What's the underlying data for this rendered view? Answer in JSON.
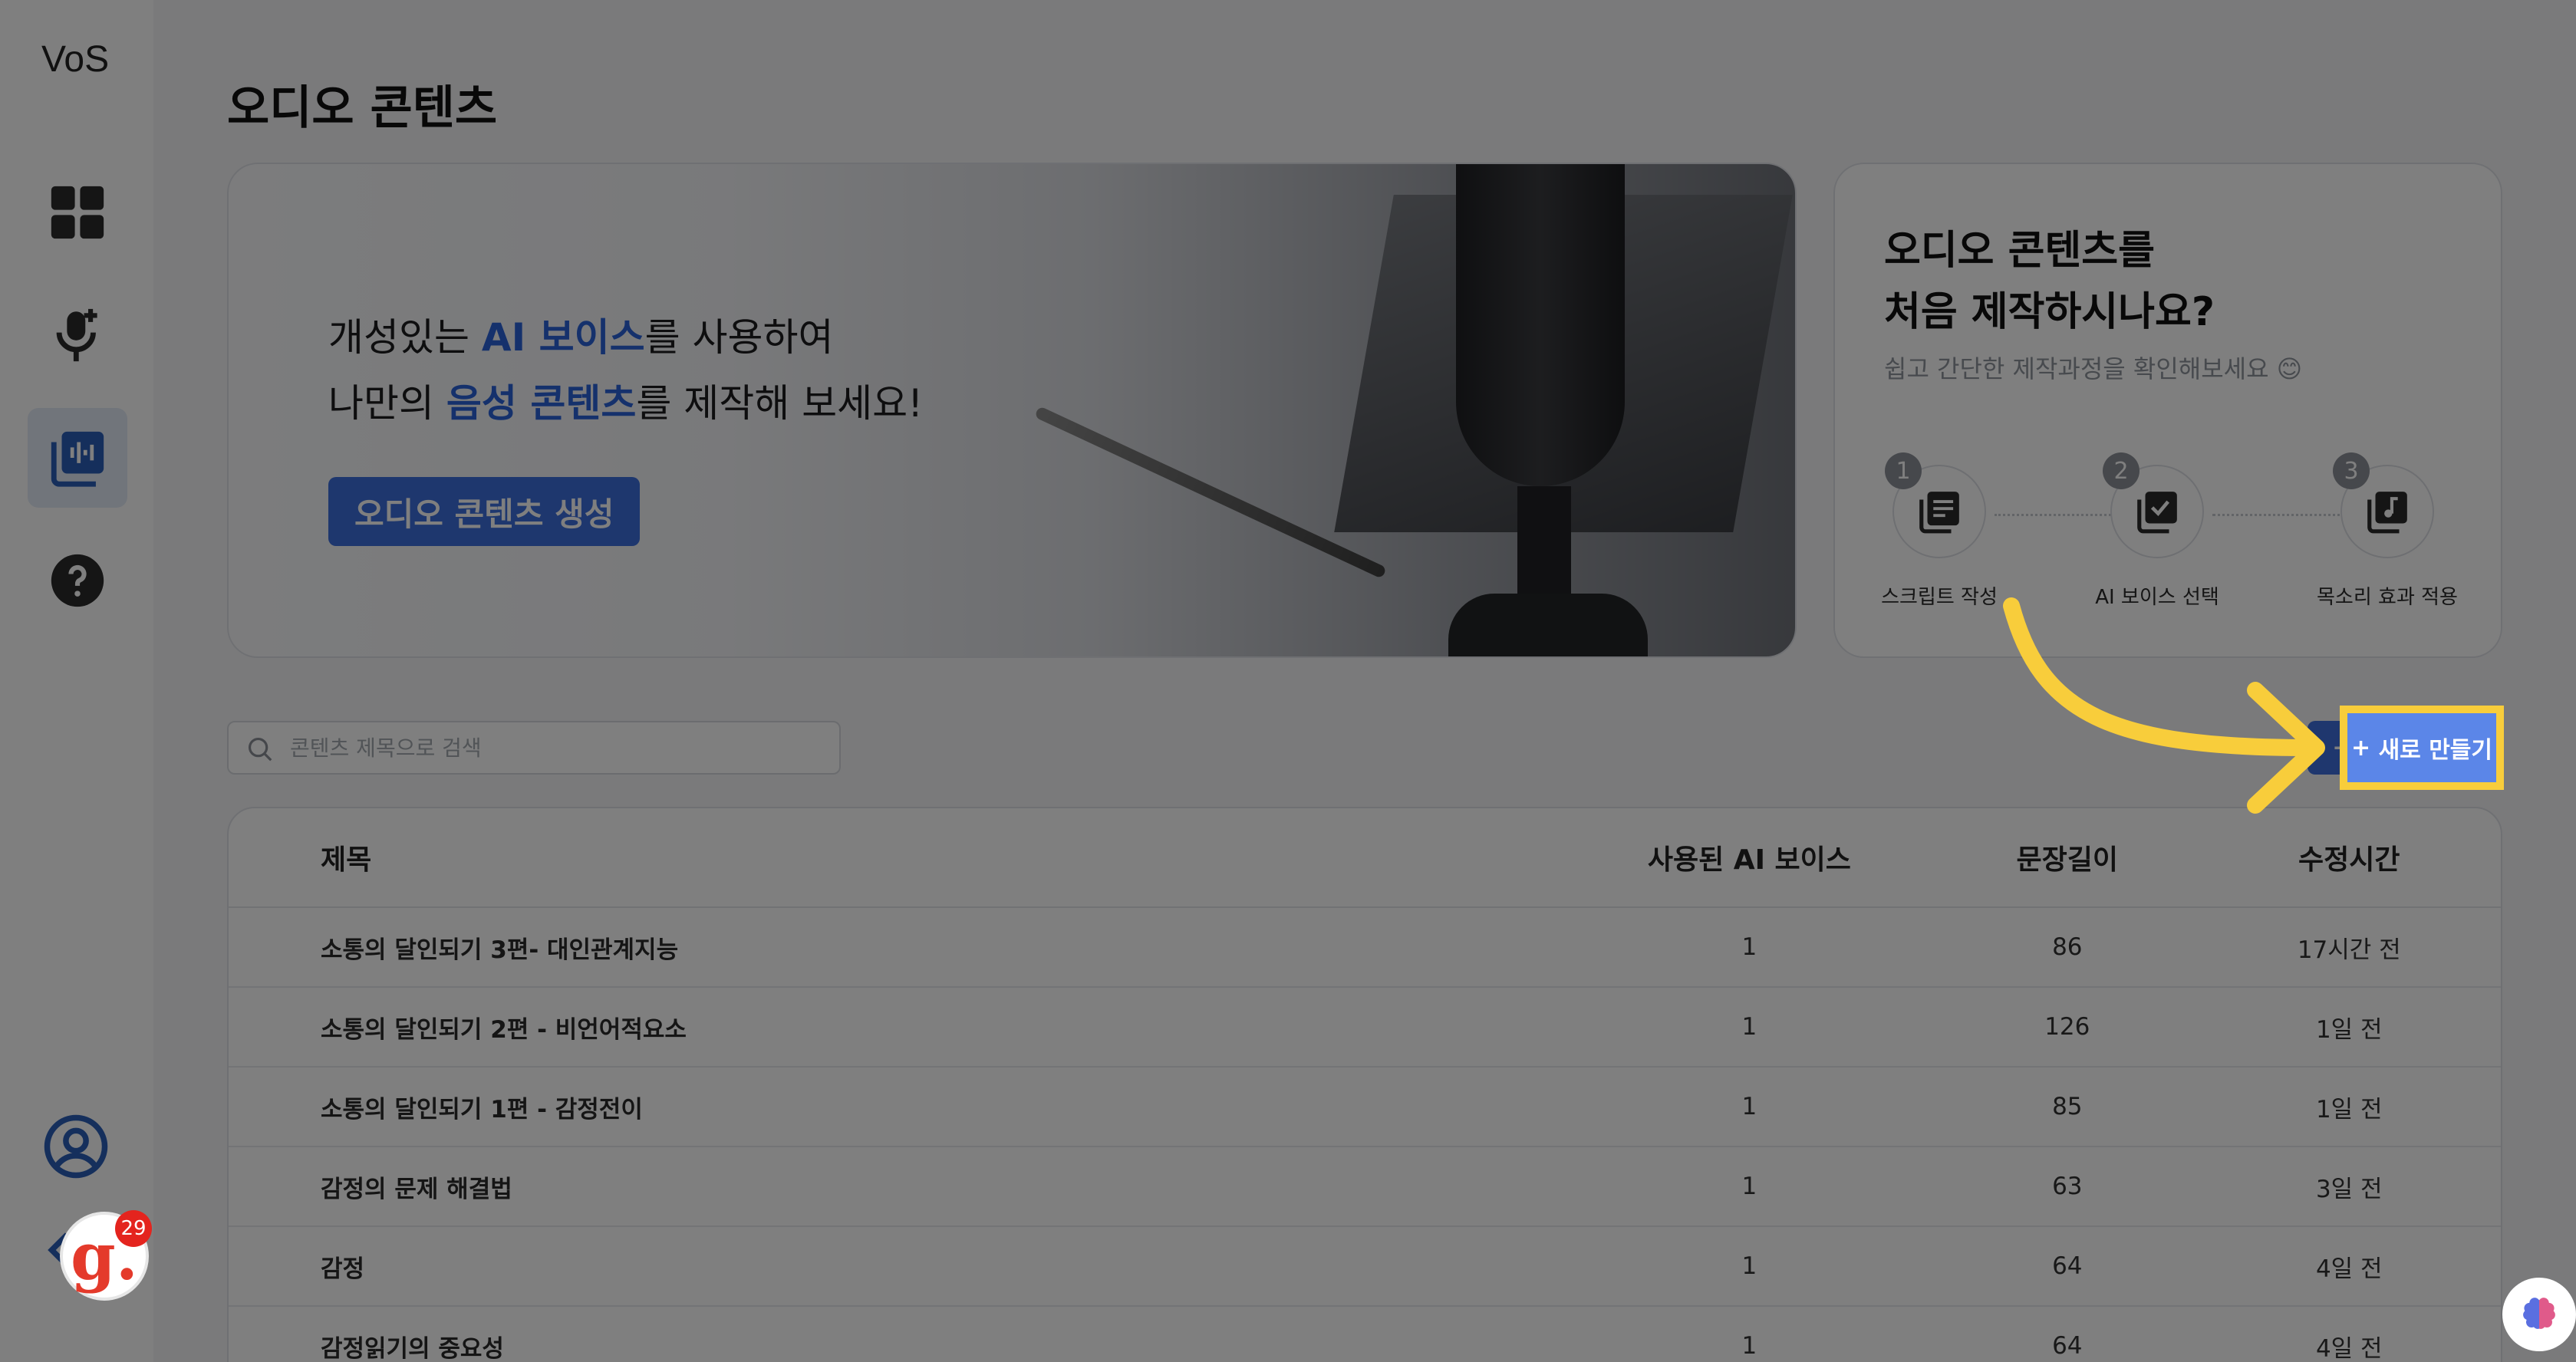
{
  "app": {
    "logo": "VoS"
  },
  "sidebar": {
    "items": [
      {
        "icon": "dashboard-icon"
      },
      {
        "icon": "mic-add-icon"
      },
      {
        "icon": "audio-library-icon",
        "active": true
      },
      {
        "icon": "help-icon"
      }
    ],
    "profile_icon": "account-icon",
    "collapse_icon": "chevron-left-icon"
  },
  "page": {
    "title": "오디오 콘텐츠"
  },
  "banner": {
    "line1_pre": "개성있는 ",
    "line1_hl": "AI 보이스",
    "line1_post": "를 사용하여",
    "line2_pre": "나만의 ",
    "line2_hl": "음성 콘텐츠",
    "line2_post": "를 제작해 보세요!",
    "cta_label": "오디오 콘텐츠 생성"
  },
  "howto": {
    "title_line1": "오디오 콘텐츠를",
    "title_line2": "처음 제작하시나요?",
    "subtitle": "쉽고 간단한 제작과정을 확인해보세요 😊",
    "steps": [
      {
        "num": "1",
        "label": "스크립트 작성",
        "icon": "script-icon"
      },
      {
        "num": "2",
        "label": "AI 보이스 선택",
        "icon": "checkbox-icon"
      },
      {
        "num": "3",
        "label": "목소리 효과 적용",
        "icon": "music-note-icon"
      }
    ]
  },
  "search": {
    "placeholder": "콘텐츠 제목으로 검색",
    "value": ""
  },
  "new_button": {
    "plus": "+",
    "label": "새로 만들기"
  },
  "table": {
    "headers": {
      "title": "제목",
      "voice": "사용된 AI 보이스",
      "length": "문장길이",
      "time": "수정시간"
    },
    "rows": [
      {
        "title": "소통의 달인되기 3편- 대인관계지능",
        "voice": "1",
        "length": "86",
        "time": "17시간 전"
      },
      {
        "title": "소통의 달인되기 2편 - 비언어적요소",
        "voice": "1",
        "length": "126",
        "time": "1일 전"
      },
      {
        "title": "소통의 달인되기 1편 - 감정전이",
        "voice": "1",
        "length": "85",
        "time": "1일 전"
      },
      {
        "title": "감정의 문제 해결법",
        "voice": "1",
        "length": "63",
        "time": "3일 전"
      },
      {
        "title": "감정",
        "voice": "1",
        "length": "64",
        "time": "4일 전"
      },
      {
        "title": "감정읽기의 중요성",
        "voice": "1",
        "length": "64",
        "time": "4일 전"
      }
    ]
  },
  "extension_badge": {
    "letter": "g.",
    "count": "29"
  },
  "colors": {
    "accent": "#3e6fdd",
    "highlight": "#f8cd3b",
    "overlay": "rgba(0,0,0,0.5)"
  }
}
